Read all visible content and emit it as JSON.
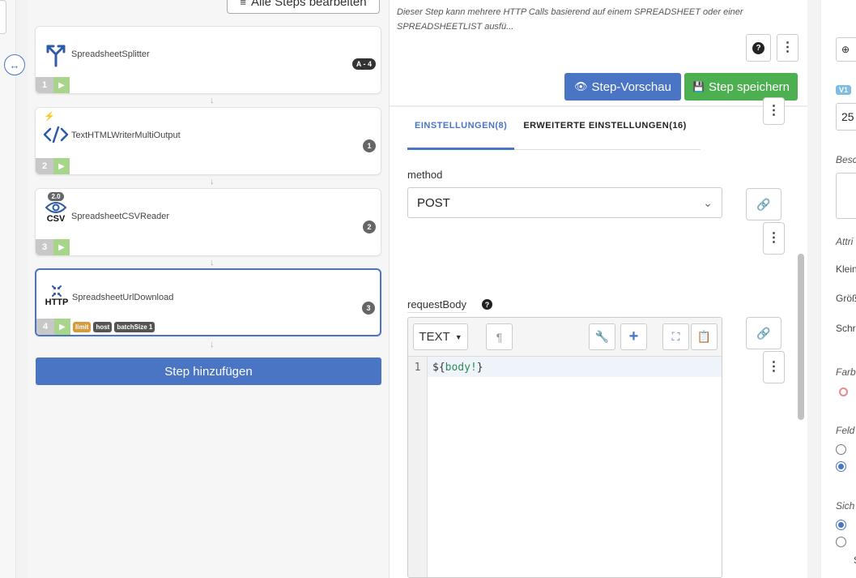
{
  "steps_panel": {
    "edit_all_label": "Alle Steps bearbeiten",
    "add_step_label": "Step hinzufügen",
    "steps": [
      {
        "name": "SpreadsheetSplitter",
        "badge": "A - 4",
        "number": "1",
        "icon": "split-icon"
      },
      {
        "name": "TextHTMLWriterMultiOutput",
        "badge": "1",
        "number": "2",
        "icon": "code-icon"
      },
      {
        "name": "SpreadsheetCSVReader",
        "badge": "2",
        "number": "3",
        "icon": "eye-icon",
        "version": "2.0",
        "icon_label": "CSV"
      },
      {
        "name": "SpreadsheetUrlDownload",
        "badge": "3",
        "number": "4",
        "icon": "http-icon",
        "icon_label": "HTTP",
        "tags": [
          "limit",
          "host",
          "batchSize 1"
        ]
      }
    ]
  },
  "editor": {
    "description": "Dieser Step kann mehrere HTTP Calls basierend auf einem SPREADSHEET oder einer SPREADSHEETLIST ausfü...",
    "preview_label": "Step-Vorschau",
    "save_label": "Step speichern",
    "tabs": [
      {
        "label": "EINSTELLUNGEN(8)",
        "active": true
      },
      {
        "label": "ERWEITERTE EINSTELLUNGEN(16)",
        "active": false
      }
    ],
    "method_label": "method",
    "method_value": "POST",
    "request_body_label": "requestBody",
    "code_mode": "TEXT",
    "code_line_number": "1",
    "code_prefix": "${",
    "code_var": "body!",
    "code_suffix": "}"
  },
  "right_panel": {
    "version_badge": "V1",
    "value_fragment": "25",
    "label_besc": "Besc",
    "label_attr": "Attri",
    "label_klein": "Klein",
    "label_gross": "Größ",
    "label_schr": "Schr",
    "label_farb": "Farb",
    "label_feld": "Feld",
    "label_sich": "Sich",
    "fragment_s": "S"
  },
  "colors": {
    "primary": "#4a74c4",
    "success": "#4caf50",
    "play": "#a7d58a",
    "tag_limit": "#d49a3b"
  }
}
